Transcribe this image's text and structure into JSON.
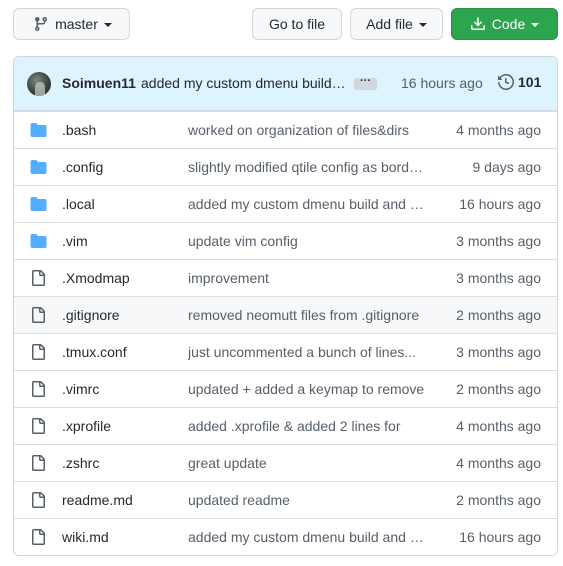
{
  "toolbar": {
    "branch_label": "master",
    "go_to_file_label": "Go to file",
    "add_file_label": "Add file",
    "code_label": "Code"
  },
  "latest_commit": {
    "author": "Soimuen11",
    "message": "added my custom dmenu build and updated wiki.md",
    "time": "16 hours ago",
    "commit_count": "101"
  },
  "files": [
    {
      "name": ".bash",
      "type": "folder",
      "message": "worked on organization of files&dirs",
      "age": "4 months ago"
    },
    {
      "name": ".config",
      "type": "folder",
      "message": "slightly modified qtile config as borders",
      "age": "9 days ago"
    },
    {
      "name": ".local",
      "type": "folder",
      "message": "added my custom dmenu build and updated",
      "age": "16 hours ago"
    },
    {
      "name": ".vim",
      "type": "folder",
      "message": "update vim config",
      "age": "3 months ago"
    },
    {
      "name": ".Xmodmap",
      "type": "file",
      "message": "improvement",
      "age": "3 months ago"
    },
    {
      "name": ".gitignore",
      "type": "file",
      "message": "removed neomutt files from .gitignore",
      "age": "2 months ago"
    },
    {
      "name": ".tmux.conf",
      "type": "file",
      "message": "just uncommented a bunch of lines...",
      "age": "3 months ago"
    },
    {
      "name": ".vimrc",
      "type": "file",
      "message": "updated + added a keymap to remove",
      "age": "2 months ago"
    },
    {
      "name": ".xprofile",
      "type": "file",
      "message": "added .xprofile & added 2 lines for",
      "age": "4 months ago"
    },
    {
      "name": ".zshrc",
      "type": "file",
      "message": "great update",
      "age": "4 months ago"
    },
    {
      "name": "readme.md",
      "type": "file",
      "message": "updated readme",
      "age": "2 months ago"
    },
    {
      "name": "wiki.md",
      "type": "file",
      "message": "added my custom dmenu build and updated",
      "age": "16 hours ago"
    }
  ],
  "colors": {
    "folder": "#54aeff",
    "file_icon": "#57606a",
    "code_button": "#2da44e",
    "header_bg": "#ddf4ff"
  }
}
